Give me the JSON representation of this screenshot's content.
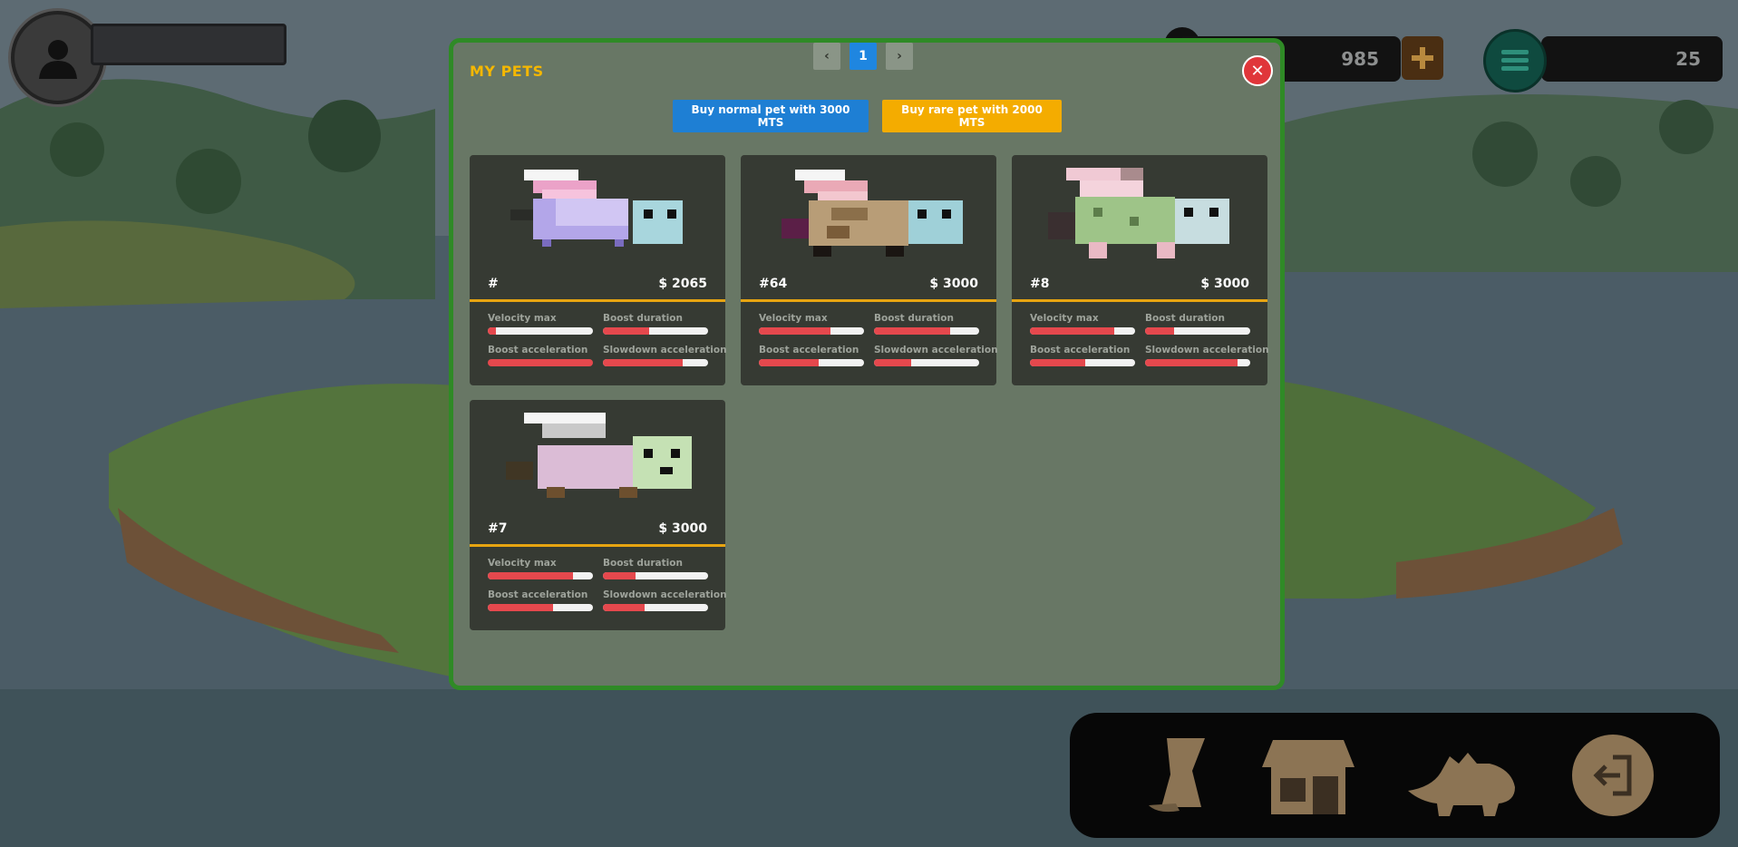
{
  "hud": {
    "coins": "985",
    "level": "25"
  },
  "modal": {
    "title": "MY PETS",
    "buy_normal_label": "Buy normal pet with 3000 MTS",
    "buy_rare_label": "Buy rare pet with 2000 MTS",
    "close_symbol": "✕",
    "stat_labels": {
      "velocity_max": "Velocity max",
      "boost_duration": "Boost duration",
      "boost_acceleration": "Boost acceleration",
      "slowdown_acceleration": "Slowdown acceleration"
    },
    "pets": [
      {
        "id": "#",
        "price": "$ 2065",
        "stats": {
          "velocity_max": 0.08,
          "boost_duration": 0.44,
          "boost_acceleration": 1.0,
          "slowdown_acceleration": 0.76
        }
      },
      {
        "id": "#64",
        "price": "$ 3000",
        "stats": {
          "velocity_max": 0.68,
          "boost_duration": 0.72,
          "boost_acceleration": 0.57,
          "slowdown_acceleration": 0.35
        }
      },
      {
        "id": "#8",
        "price": "$ 3000",
        "stats": {
          "velocity_max": 0.8,
          "boost_duration": 0.28,
          "boost_acceleration": 0.53,
          "slowdown_acceleration": 0.88
        }
      },
      {
        "id": "#7",
        "price": "$ 3000",
        "stats": {
          "velocity_max": 0.81,
          "boost_duration": 0.31,
          "boost_acceleration": 0.62,
          "slowdown_acceleration": 0.4
        }
      }
    ],
    "pagination": {
      "prev": "‹",
      "current": "1",
      "next": "›"
    }
  },
  "toolbar": {
    "items": [
      "scroll-icon",
      "shop-icon",
      "dinosaur-icon",
      "exit-icon"
    ]
  },
  "colors": {
    "modal_border": "#2f8a26",
    "title": "#f5b700",
    "accent_blue": "#1e7fd4",
    "accent_orange": "#f4ac00",
    "stat_fill": "#e5484d"
  }
}
